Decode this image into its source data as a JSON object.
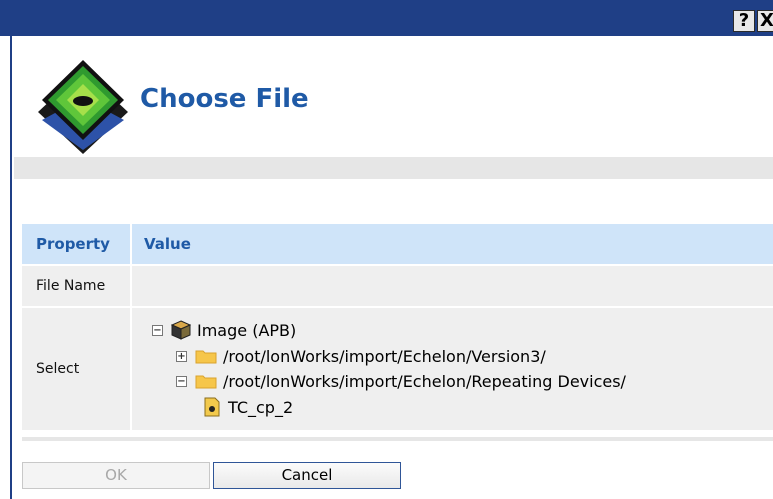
{
  "window": {
    "help_glyph": "?",
    "close_glyph": "X"
  },
  "page": {
    "title": "Choose File"
  },
  "table": {
    "headers": [
      "Property",
      "Value"
    ],
    "rows": {
      "file_name_label": "File Name",
      "file_name_value": "",
      "select_label": "Select"
    }
  },
  "tree": {
    "root": {
      "label": "Image (APB)",
      "expanded": true,
      "icon": "cube-icon"
    },
    "folder1": {
      "label": "/root/lonWorks/import/Echelon/Version3/",
      "expanded": false,
      "icon": "folder-icon"
    },
    "folder2": {
      "label": "/root/lonWorks/import/Echelon/Repeating Devices/",
      "expanded": true,
      "icon": "folder-icon"
    },
    "file1": {
      "label": "TC_cp_2",
      "icon": "device-file-icon"
    }
  },
  "toggles": {
    "expanded": "−",
    "collapsed": "+"
  },
  "buttons": {
    "ok": "OK",
    "cancel": "Cancel"
  },
  "colors": {
    "titlebar": "#1f3f86",
    "accent_text": "#1f5aa6",
    "header_bg": "#cfe4f9",
    "row_bg": "#efefef"
  }
}
